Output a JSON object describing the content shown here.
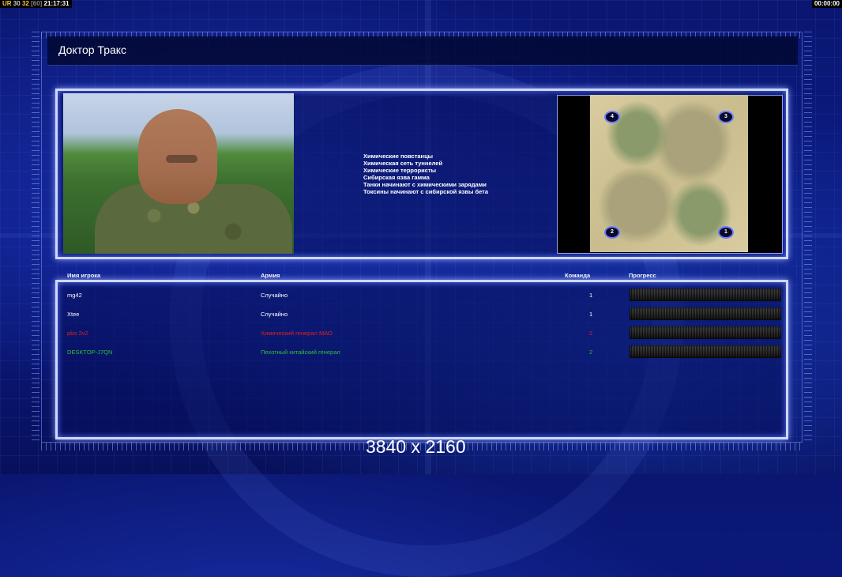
{
  "hud": {
    "left_segments": [
      "UR",
      "30",
      "32",
      "[60]",
      "21:17:31"
    ],
    "timer": "00:00:00"
  },
  "window": {
    "title": "Доктор Тракс"
  },
  "briefing": {
    "objectives": [
      "Химические повстанцы",
      "Химическая сеть туннелей",
      "Химические террористы",
      "Сибирская язва гамма",
      "Танки начинают с химическими зарядами",
      "Токсины начинают с сибирской язвы бета"
    ],
    "map_markers": [
      "4",
      "3",
      "2",
      "1"
    ]
  },
  "table": {
    "headers": {
      "player": "Имя игрока",
      "army": "Армия",
      "team": "Команда",
      "progress": "Прогресс"
    },
    "rows": [
      {
        "player": "mg42",
        "army": "Случайно",
        "team": "1",
        "color": "#ffffff"
      },
      {
        "player": "Xtee",
        "army": "Случайно",
        "team": "1",
        "color": "#ffffff"
      },
      {
        "player": "pbo 2v2",
        "army": "Химический генерал МАО",
        "team": "2",
        "color": "#e0201c"
      },
      {
        "player": "DESKTOP-J7QN",
        "army": "Пехотный китайский генерал",
        "team": "2",
        "color": "#2fbf3a"
      }
    ]
  },
  "overlay": {
    "resolution": "3840 x 2160"
  }
}
